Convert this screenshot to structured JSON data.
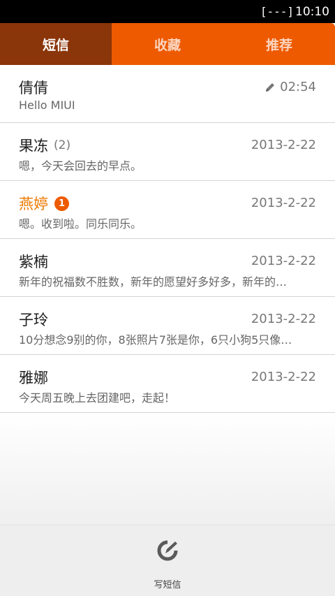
{
  "status": {
    "battery": "[---]",
    "time": "10:10"
  },
  "tabs": [
    {
      "label": "短信",
      "active": true
    },
    {
      "label": "收藏",
      "active": false
    },
    {
      "label": "推荐",
      "active": false
    }
  ],
  "conversations": [
    {
      "name": "倩倩",
      "count": "",
      "badge": "",
      "date": "02:54",
      "draft": true,
      "preview": "Hello MIUI"
    },
    {
      "name": "果冻",
      "count": "(2)",
      "badge": "",
      "date": "2013-2-22",
      "draft": false,
      "preview": "嗯，今天会回去的早点。"
    },
    {
      "name": "燕婷",
      "count": "",
      "badge": "1",
      "date": "2013-2-22",
      "draft": false,
      "preview": "嗯。收到啦。同乐同乐。"
    },
    {
      "name": "紫楠",
      "count": "",
      "badge": "",
      "date": "2013-2-22",
      "draft": false,
      "preview": "新年的祝福数不胜数，新年的愿望好多好多，新年的…"
    },
    {
      "name": "子玲",
      "count": "",
      "badge": "",
      "date": "2013-2-22",
      "draft": false,
      "preview": "10分想念9别的你，8张照片7张是你，6只小狗5只像…"
    },
    {
      "name": "雅娜",
      "count": "",
      "badge": "",
      "date": "2013-2-22",
      "draft": false,
      "preview": "今天周五晚上去团建吧，走起！"
    }
  ],
  "bottom": {
    "compose_label": "写短信",
    "compose_icon": "compose-icon"
  },
  "colors": {
    "accent": "#ee5a00",
    "active_tab": "#8b350a",
    "unread": "#ee7a00"
  }
}
